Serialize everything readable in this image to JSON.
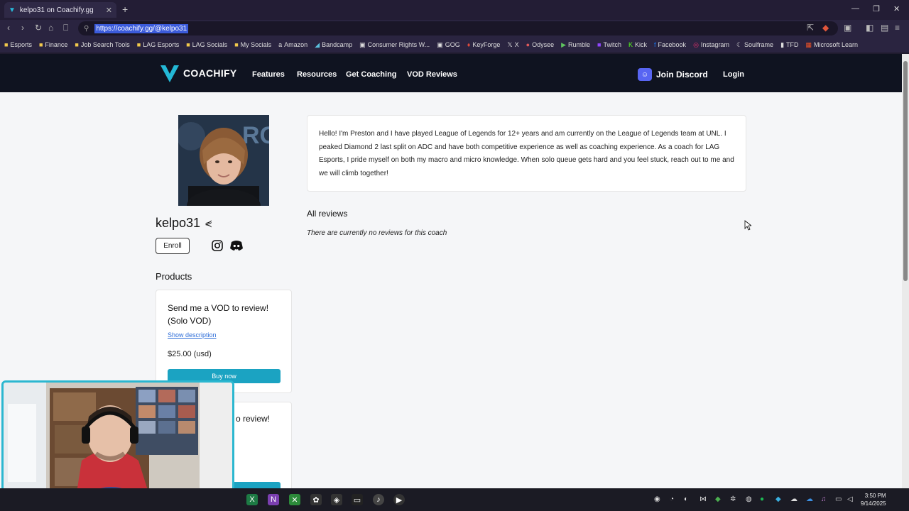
{
  "browser": {
    "tab_title": "kelpo31 on Coachify.gg",
    "url": "https://coachify.gg/@kelpo31",
    "bookmarks": [
      "Esports",
      "Finance",
      "Job Search Tools",
      "LAG Esports",
      "LAG Socials",
      "My Socials",
      "Amazon",
      "Bandcamp",
      "Consumer Rights W...",
      "GOG",
      "KeyForge",
      "X",
      "Odysee",
      "Rumble",
      "Twitch",
      "Kick",
      "Facebook",
      "Instagram",
      "Soulframe",
      "TFD",
      "Microsoft Learn"
    ]
  },
  "site": {
    "logo_text": "COACHIFY",
    "nav": [
      "Features",
      "Resources",
      "Get Coaching",
      "VOD Reviews"
    ],
    "join_discord": "Join Discord",
    "login": "Login"
  },
  "profile": {
    "username": "kelpo31",
    "enroll": "Enroll",
    "products_title": "Products",
    "bio": "Hello! I'm Preston and I have played League of Legends for 12+ years and am currently on the League of Legends team at UNL. I peaked Diamond 2 last split on ADC and have both competitive experience as well as coaching experience. As a coach for LAG Esports, I pride myself on both my macro and micro knowledge. When solo queue gets hard and you feel stuck, reach out to me and we will climb together!",
    "reviews_title": "All reviews",
    "no_reviews": "There are currently no reviews for this coach"
  },
  "products": [
    {
      "title": "Send me a VOD to review! (Solo VOD)",
      "link": "Show description",
      "price": "$25.00 (usd)",
      "buy": "Buy now"
    },
    {
      "title_fragment": "o review!"
    }
  ],
  "taskbar": {
    "time": "3:50 PM",
    "date": "9/14/2025"
  },
  "colors": {
    "header_bg": "#0f1320",
    "accent": "#1ba3c2",
    "discord": "#5865f2",
    "webcam_border": "#2bb7d0"
  }
}
